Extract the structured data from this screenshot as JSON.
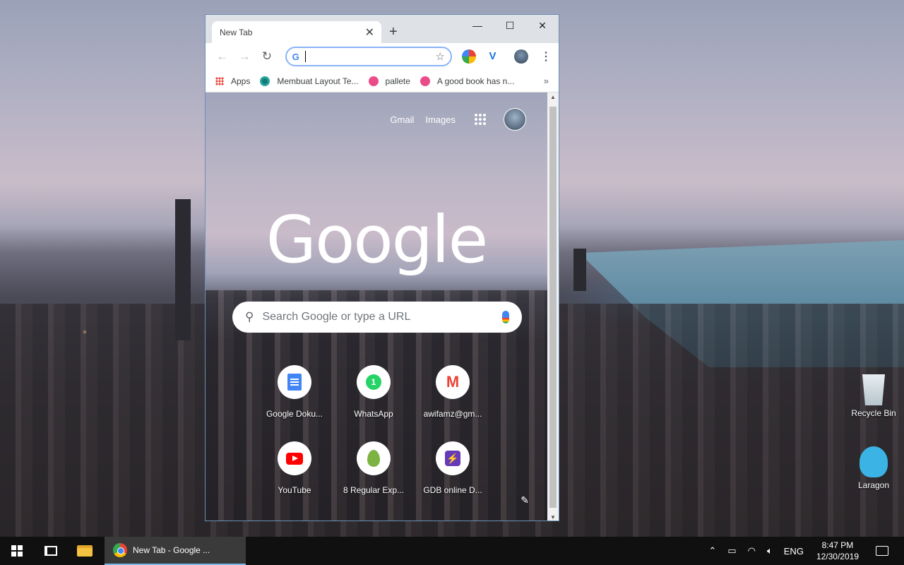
{
  "browser": {
    "tab_title": "New Tab",
    "tab_close": "✕",
    "new_tab": "+",
    "win_minimize": "—",
    "win_maximize": "☐",
    "win_close": "✕",
    "back": "←",
    "forward": "→",
    "reload": "↻",
    "omnibox_icon": "G",
    "omnibox_value": "",
    "bookmark_star": "☆",
    "menu": "⋮",
    "extensions": [
      "color-picker-extension-icon",
      "v-extension-icon"
    ]
  },
  "bookmarks": {
    "items": [
      {
        "label": "Apps",
        "icon": "apps-grid-icon"
      },
      {
        "label": "Membuat Layout Te...",
        "icon": "site-icon"
      },
      {
        "label": "pallete",
        "icon": "dribbble-icon"
      },
      {
        "label": "A good book has n...",
        "icon": "dribbble-icon"
      }
    ],
    "more": "»"
  },
  "newtab": {
    "gmail": "Gmail",
    "images": "Images",
    "logo": "Google",
    "search_placeholder": "Search Google or type a URL",
    "shortcuts": [
      {
        "label": "Google Doku...",
        "icon": "google-docs-icon"
      },
      {
        "label": "WhatsApp",
        "icon": "whatsapp-icon"
      },
      {
        "label": "awifamz@gm...",
        "icon": "gmail-icon"
      },
      {
        "label": "YouTube",
        "icon": "youtube-icon"
      },
      {
        "label": "8 Regular Exp...",
        "icon": "leaf-icon"
      },
      {
        "label": "GDB online D...",
        "icon": "gdb-icon"
      }
    ]
  },
  "desktop": {
    "icons": [
      {
        "label": "Recycle Bin"
      },
      {
        "label": "Laragon"
      }
    ]
  },
  "taskbar": {
    "chrome_label": "New Tab - Google ...",
    "language": "ENG",
    "time": "8:47 PM",
    "date": "12/30/2019"
  }
}
